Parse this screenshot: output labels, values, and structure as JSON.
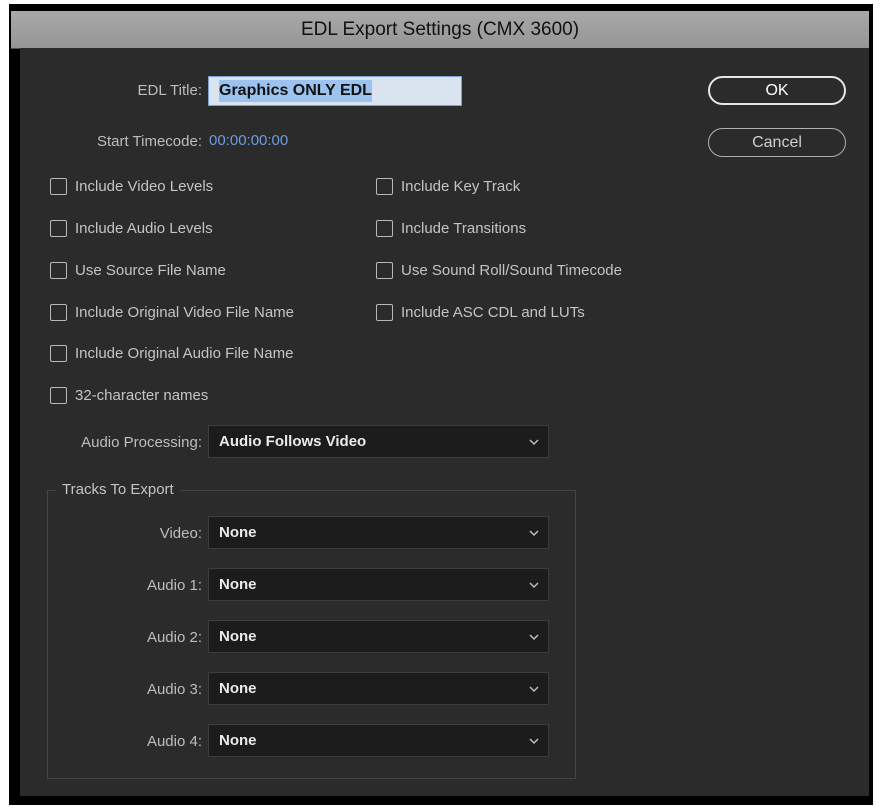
{
  "dialog": {
    "title": "EDL Export Settings (CMX 3600)"
  },
  "edl_title": {
    "label": "EDL Title:",
    "value": "Graphics ONLY EDL"
  },
  "start_timecode": {
    "label": "Start Timecode:",
    "value": "00:00:00:00"
  },
  "buttons": {
    "ok": "OK",
    "cancel": "Cancel"
  },
  "options_left": [
    {
      "label": "Include Video Levels",
      "checked": false
    },
    {
      "label": "Include Audio Levels",
      "checked": false
    },
    {
      "label": "Use Source File Name",
      "checked": false
    },
    {
      "label": "Include Original Video File Name",
      "checked": false
    },
    {
      "label": "Include Original Audio File Name",
      "checked": false
    },
    {
      "label": "32-character names",
      "checked": false
    }
  ],
  "options_right": [
    {
      "label": "Include Key Track",
      "checked": false
    },
    {
      "label": "Include Transitions",
      "checked": false
    },
    {
      "label": "Use Sound Roll/Sound Timecode",
      "checked": false
    },
    {
      "label": "Include ASC CDL and LUTs",
      "checked": false
    }
  ],
  "audio_processing": {
    "label": "Audio Processing:",
    "value": "Audio Follows Video"
  },
  "tracks": {
    "title": "Tracks To Export",
    "rows": [
      {
        "label": "Video:",
        "value": "None"
      },
      {
        "label": "Audio 1:",
        "value": "None"
      },
      {
        "label": "Audio 2:",
        "value": "None"
      },
      {
        "label": "Audio 3:",
        "value": "None"
      },
      {
        "label": "Audio 4:",
        "value": "None"
      }
    ]
  },
  "colors": {
    "background": "#2b2b2b",
    "timecode": "#6c9ce0",
    "input_highlight": "#9cc2ee"
  }
}
